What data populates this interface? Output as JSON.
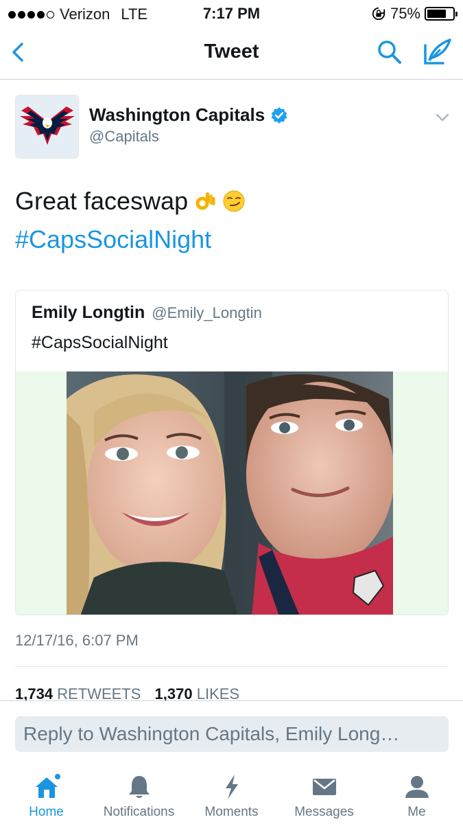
{
  "status_bar": {
    "carrier": "Verizon",
    "network": "LTE",
    "time": "7:17 PM",
    "battery": "75%",
    "battery_level": 0.75
  },
  "nav": {
    "title": "Tweet",
    "back_icon": "chevron-left-icon",
    "search_icon": "search-icon",
    "compose_icon": "compose-icon"
  },
  "tweet": {
    "author_name": "Washington Capitals",
    "author_handle": "@Capitals",
    "text": "Great faceswap",
    "emojis": [
      "ok-hand-emoji",
      "smirk-emoji"
    ],
    "hashtag": "#CapsSocialNight",
    "timestamp": "12/17/16, 6:07 PM",
    "retweets_count": "1,734",
    "retweets_label": "RETWEETS",
    "likes_count": "1,370",
    "likes_label": "LIKES"
  },
  "quote": {
    "author_name": "Emily Longtin",
    "author_handle": "@Emily_Longtin",
    "text": "#CapsSocialNight"
  },
  "reply": {
    "placeholder": "Reply to Washington Capitals, Emily Long…"
  },
  "tabs": [
    {
      "label": "Home",
      "icon": "home-icon",
      "active": true
    },
    {
      "label": "Notifications",
      "icon": "bell-icon",
      "active": false
    },
    {
      "label": "Moments",
      "icon": "lightning-icon",
      "active": false
    },
    {
      "label": "Messages",
      "icon": "envelope-icon",
      "active": false
    },
    {
      "label": "Me",
      "icon": "person-icon",
      "active": false
    }
  ],
  "colors": {
    "accent": "#1b95e0",
    "text": "#14171a",
    "muted": "#657786",
    "border": "#e1e8ed",
    "reply_bg": "#e6ecf0",
    "media_bg": "#ecfaeb"
  }
}
